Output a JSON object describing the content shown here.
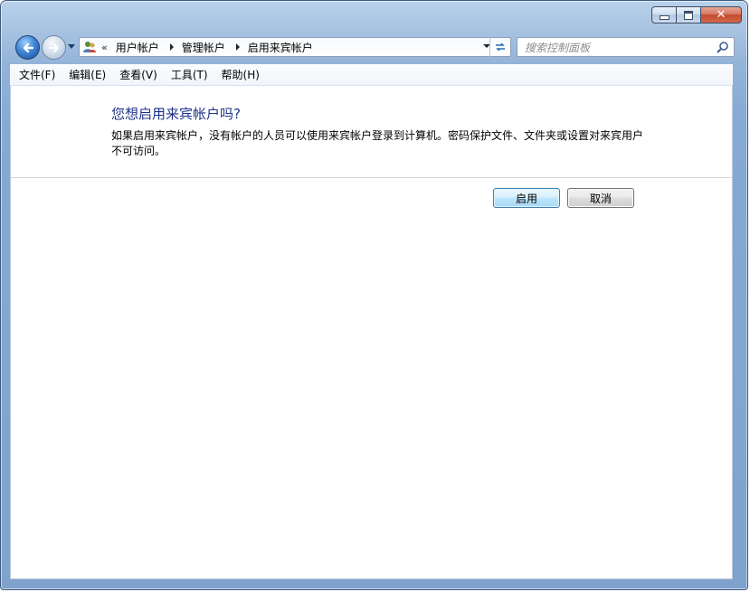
{
  "window": {
    "controls": {
      "minimize_icon": "minimize-icon",
      "maximize_icon": "maximize-icon",
      "close_glyph": "✕"
    }
  },
  "navigation": {
    "back_icon": "back-arrow-icon",
    "forward_icon": "forward-arrow-icon",
    "history_icon": "history-dropdown-icon"
  },
  "address_bar": {
    "location_icon": "user-accounts-icon",
    "overflow_glyph": "«",
    "breadcrumbs": [
      "用户帐户",
      "管理帐户",
      "启用来宾帐户"
    ]
  },
  "search": {
    "placeholder": "搜索控制面板"
  },
  "menu": {
    "items": [
      "文件(F)",
      "编辑(E)",
      "查看(V)",
      "工具(T)",
      "帮助(H)"
    ]
  },
  "content": {
    "heading": "您想启用来宾帐户吗?",
    "description": "如果启用来宾帐户，没有帐户的人员可以使用来宾帐户登录到计算机。密码保护文件、文件夹或设置对来宾用户不可访问。"
  },
  "buttons": {
    "enable": "启用",
    "cancel": "取消"
  },
  "colors": {
    "heading": "#1e3287",
    "frame": "#86a9d2",
    "close_button": "#c24a2d"
  }
}
